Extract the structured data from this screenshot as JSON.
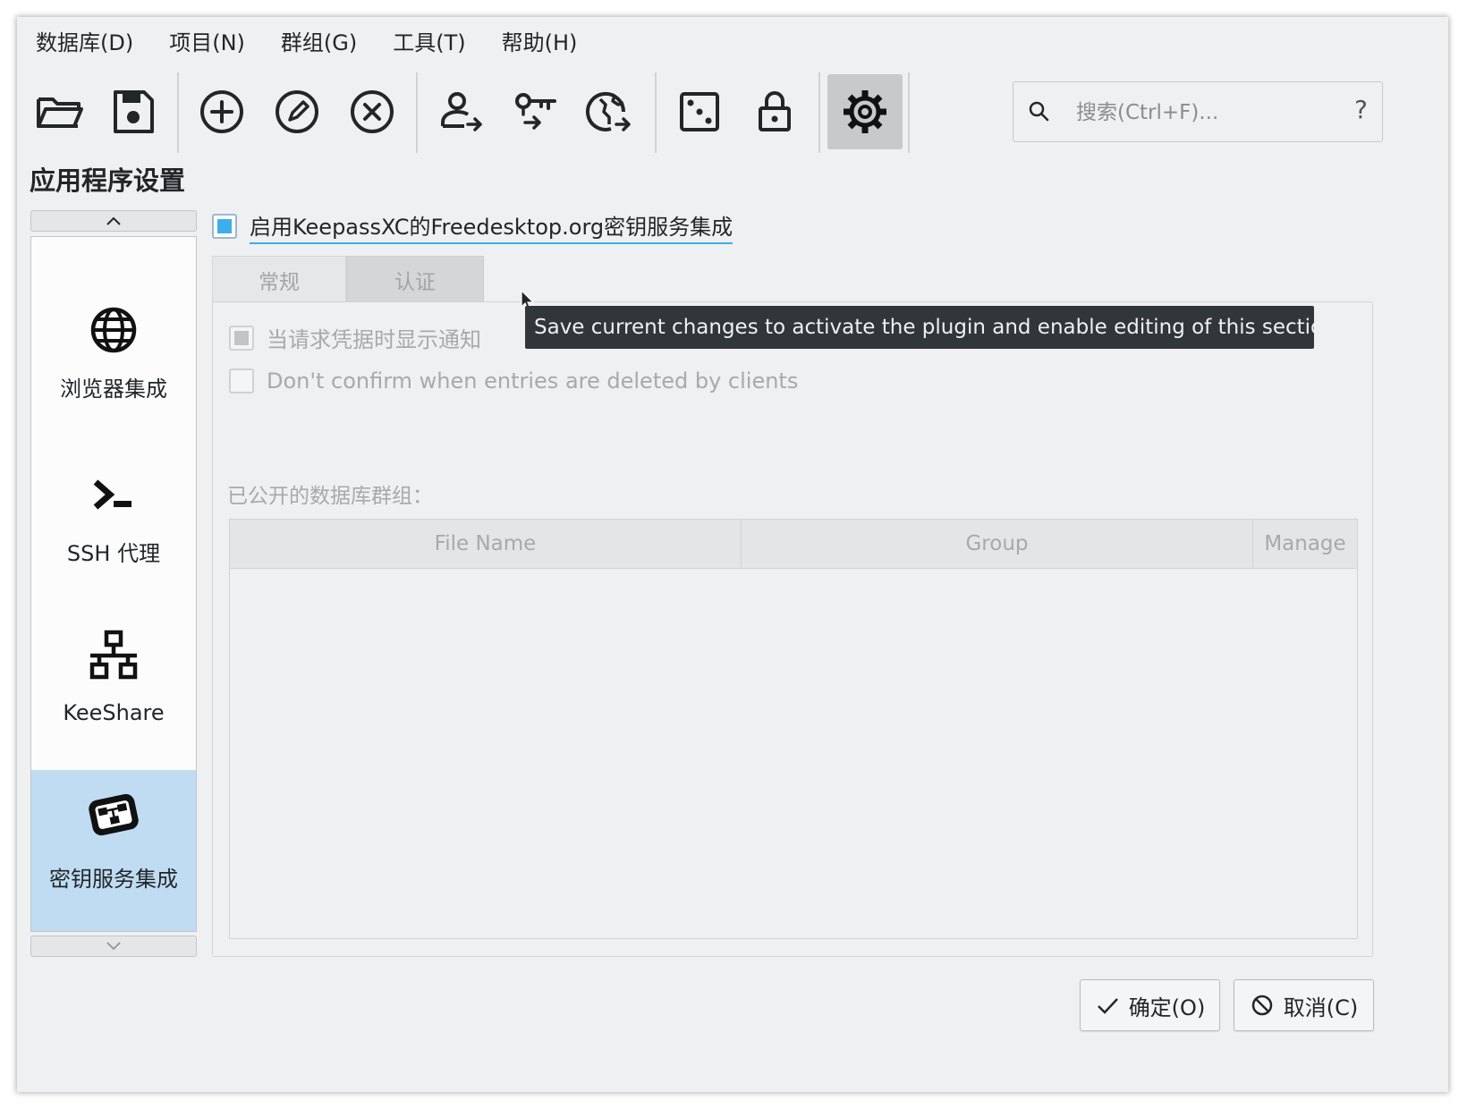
{
  "menu": {
    "items": [
      "数据库(D)",
      "项目(N)",
      "群组(G)",
      "工具(T)",
      "帮助(H)"
    ]
  },
  "toolbar": {
    "buttons": [
      {
        "icon": "folder-open-icon"
      },
      {
        "icon": "save-icon"
      },
      {
        "icon": "add-entry-icon"
      },
      {
        "icon": "edit-entry-icon"
      },
      {
        "icon": "delete-entry-icon"
      },
      {
        "icon": "copy-username-icon"
      },
      {
        "icon": "copy-password-icon"
      },
      {
        "icon": "copy-url-icon"
      },
      {
        "icon": "password-generator-icon"
      },
      {
        "icon": "lock-database-icon"
      },
      {
        "icon": "settings-icon",
        "active": true
      }
    ]
  },
  "search": {
    "placeholder": "搜索(Ctrl+F)...",
    "value": "",
    "help": "?"
  },
  "page": {
    "title": "应用程序设置"
  },
  "sidebar": {
    "items": [
      {
        "label": "浏览器集成",
        "icon": "globe-icon"
      },
      {
        "label": "SSH 代理",
        "icon": "terminal-icon"
      },
      {
        "label": "KeeShare",
        "icon": "network-icon"
      },
      {
        "label": "密钥服务集成",
        "icon": "secret-service-icon",
        "selected": true
      }
    ]
  },
  "secret_service": {
    "enable_label": "启用KeepassXC的Freedesktop.org密钥服务集成",
    "enable_checked": "partial",
    "tabs": [
      "常规",
      "认证"
    ],
    "options": [
      {
        "label": "当请求凭据时显示通知",
        "checked": true,
        "disabled": true
      },
      {
        "label": "Don't confirm when entries are deleted by clients",
        "checked": false,
        "disabled": true
      }
    ],
    "exposed_groups_label": "已公开的数据库群组：",
    "table": {
      "columns": [
        "File Name",
        "Group",
        "Manage"
      ],
      "rows": []
    }
  },
  "tooltip": {
    "text": "Save current changes to activate the plugin and enable editing of this section."
  },
  "buttons": {
    "ok": "确定(O)",
    "cancel": "取消(C)"
  },
  "colors": {
    "accent": "#3daee9",
    "selected_bg": "#bfdcf2",
    "window_bg": "#eff0f1",
    "tooltip_bg": "#31363b"
  }
}
